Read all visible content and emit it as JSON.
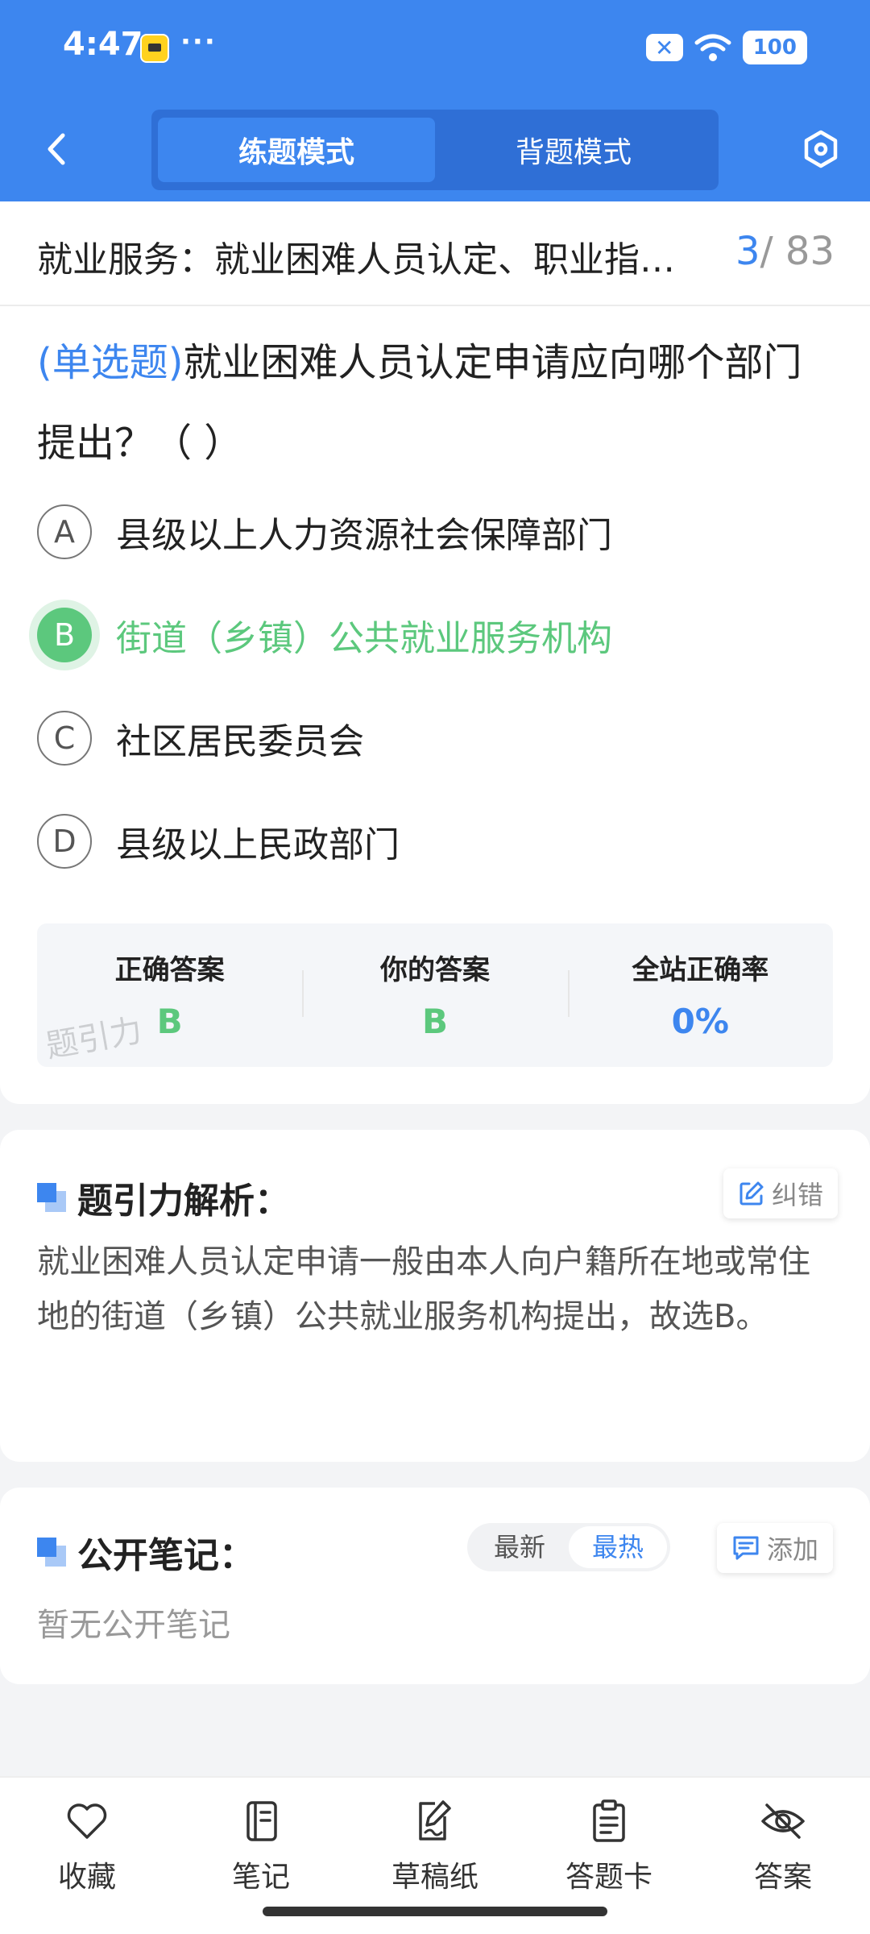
{
  "status_bar": {
    "time": "4:47",
    "dots": "···",
    "x_badge": "✕",
    "battery": "100"
  },
  "header": {
    "tabs": [
      {
        "label": "练题模式",
        "active": true
      },
      {
        "label": "背题模式",
        "active": false
      }
    ],
    "back_icon": "chevron-left-icon",
    "settings_icon": "hex-gear-icon"
  },
  "title_row": {
    "section_title": "就业服务：就业困难人员认定、职业指…",
    "current": "3",
    "total": "/ 83"
  },
  "question": {
    "type": "(单选题)",
    "text": "就业困难人员认定申请应向哪个部门提出？（        ）",
    "options": [
      {
        "letter": "A",
        "text": "县级以上人力资源社会保障部门",
        "state": "normal"
      },
      {
        "letter": "B",
        "text": "街道（乡镇）公共就业服务机构",
        "state": "correct"
      },
      {
        "letter": "C",
        "text": "社区居民委员会",
        "state": "normal"
      },
      {
        "letter": "D",
        "text": "县级以上民政部门",
        "state": "normal"
      }
    ]
  },
  "answer_summary": {
    "correct_label": "正确答案",
    "correct_value": "B",
    "yours_label": "你的答案",
    "yours_value": "B",
    "rate_label": "全站正确率",
    "rate_value": "0%",
    "watermark": "题引力"
  },
  "analysis": {
    "heading": "题引力解析：",
    "report_label": "纠错",
    "text": "就业困难人员认定申请一般由本人向户籍所在地或常住地的街道（乡镇）公共就业服务机构提出，故选B。"
  },
  "notes": {
    "heading": "公开笔记：",
    "sort_options": [
      "最新",
      "最热"
    ],
    "active_sort": "最热",
    "add_label": "添加",
    "empty_text": "暂无公开笔记"
  },
  "bottom_nav": [
    {
      "label": "收藏",
      "icon": "heart-icon"
    },
    {
      "label": "笔记",
      "icon": "notebook-icon"
    },
    {
      "label": "草稿纸",
      "icon": "draft-paper-icon"
    },
    {
      "label": "答题卡",
      "icon": "answer-card-icon"
    },
    {
      "label": "答案",
      "icon": "eye-off-icon"
    }
  ],
  "colors": {
    "primary": "#3d86ef",
    "correct": "#5cc87d"
  }
}
